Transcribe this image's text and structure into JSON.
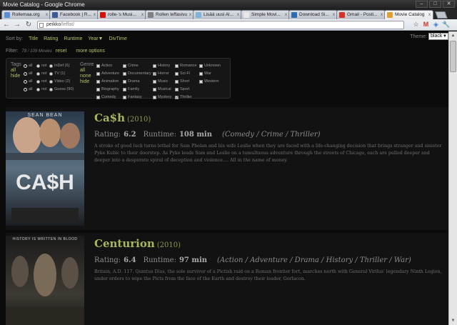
{
  "window": {
    "title": "Movie Catalog - Google Chrome",
    "btn_min": "–",
    "btn_max": "□",
    "btn_close": "✕"
  },
  "tabs": [
    {
      "label": "Rollemaa.org",
      "color": "#5a8fd4"
    },
    {
      "label": "Facebook | R...",
      "color": "#3b5998"
    },
    {
      "label": "rolle-'s Musi...",
      "color": "#d51007"
    },
    {
      "label": "Rollen leffasivu",
      "color": "#808080"
    },
    {
      "label": "Lisää uusi Al...",
      "color": "#7fb3d9"
    },
    {
      "label": "Simple Movi...",
      "color": "#e8e8e8"
    },
    {
      "label": "Download Si...",
      "color": "#2a6db0"
    },
    {
      "label": "Gmail - Posti...",
      "color": "#d93025"
    },
    {
      "label": "Movie Catalog",
      "color": "#e0a030"
    }
  ],
  "tab_close": "x",
  "toolbar": {
    "back": "←",
    "forward": "→",
    "reload": "↻",
    "url_host": "peikko",
    "url_path": "/leffat/",
    "star": "☆",
    "gmail": "M",
    "ext": "◈",
    "wrench": "🔧"
  },
  "sort": {
    "label": "Sort by:",
    "items": [
      "Title",
      "Rating",
      "Runtime",
      "Year▼",
      "DivTime"
    ]
  },
  "theme": {
    "label": "Theme:",
    "value": "black",
    "caret": "▼"
  },
  "filter": {
    "label": "Filter:",
    "count": "78 / 109 Movies",
    "reset": "reset",
    "more": "more options"
  },
  "tags": {
    "label": "Tags",
    "links": [
      "all",
      "hide"
    ],
    "col1": [
      "all",
      "all",
      "all",
      "all"
    ],
    "col2": [
      "not",
      "not",
      "not",
      "not"
    ],
    "col3": [
      "InDef (6)",
      "TV (1)",
      "Video (2)",
      "Guess (90)"
    ]
  },
  "genre": {
    "label": "Genre",
    "links": [
      "all",
      "none",
      "hide"
    ],
    "col1": [
      "Action",
      "Adventure",
      "Animation",
      "Biography",
      "Comedy"
    ],
    "col2": [
      "Crime",
      "Documentary",
      "Drama",
      "Family",
      "Fantasy"
    ],
    "col3": [
      "History",
      "Horror",
      "Music",
      "Musical",
      "Mystery"
    ],
    "col4": [
      "Romance",
      "Sci-Fi",
      "Short",
      "Sport",
      "Thriller"
    ],
    "col5": [
      "Unknown",
      "War",
      "Western"
    ],
    "checked_mark": "✓"
  },
  "movies": [
    {
      "title": "Ca$h",
      "year": "(2010)",
      "rating_label": "Rating:",
      "rating": "6.2",
      "runtime_label": "Runtime:",
      "runtime": "108 min",
      "genres": "(Comedy / Crime / Thriller)",
      "description": "A stroke of good luck turns lethal for Sam Phelan and his wife Leslie when they are faced with a life-changing decision that brings stranger and sinister Pyke Kubic to their doorstep. As Pyke leads Sam and Leslie on a tumultuous adventure through the streets of Chicago, each are pulled deeper and deeper into a desperate spiral of deception and violence.... All in the name of money.",
      "poster_top": "SEAN BEAN",
      "poster_title": "CA$H"
    },
    {
      "title": "Centurion",
      "year": "(2010)",
      "rating_label": "Rating:",
      "rating": "6.4",
      "runtime_label": "Runtime:",
      "runtime": "97 min",
      "genres": "(Action / Adventure / Drama / History / Thriller / War)",
      "description": "Britain, A.D. 117. Quintus Dias, the sole survivor of a Pictish raid on a Roman frontier fort, marches north with General Virilus' legendary Ninth Legion, under orders to wipe the Picts from the face of the Earth and destroy their leader, Gorlacon.",
      "poster_top": "HISTORY IS WRITTEN IN BLOOD"
    }
  ]
}
